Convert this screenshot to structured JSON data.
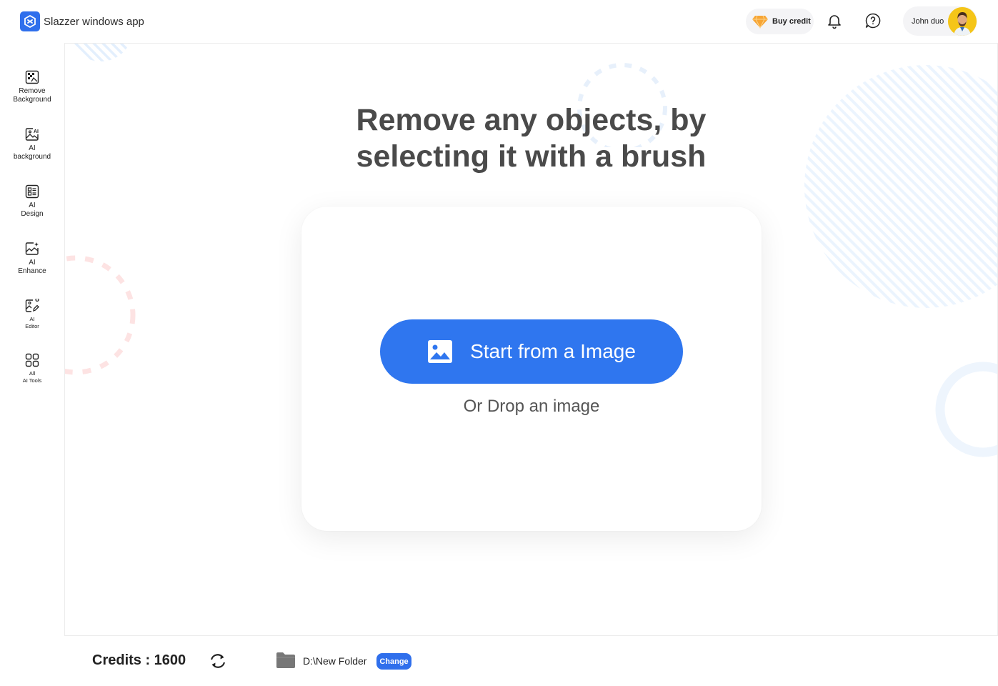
{
  "header": {
    "app_title": "Slazzer windows app",
    "buy_credit_label": "Buy credit",
    "user_name": "John duo"
  },
  "sidebar": {
    "items": [
      {
        "line1": "Remove",
        "line2": "Background",
        "icon": "remove-background-icon"
      },
      {
        "line1": "AI",
        "line2": "background",
        "icon": "ai-background-icon"
      },
      {
        "line1": "AI",
        "line2": "Design",
        "icon": "ai-design-icon"
      },
      {
        "line1": "AI",
        "line2": "Enhance",
        "icon": "ai-enhance-icon"
      },
      {
        "line1": "AI",
        "line2": "Editor",
        "icon": "ai-editor-icon"
      },
      {
        "line1": "All",
        "line2": "AI Tools",
        "icon": "grid-icon"
      }
    ]
  },
  "main": {
    "headline_line1": "Remove any objects, by",
    "headline_line2": "selecting it with a brush",
    "start_button_label": "Start from a Image",
    "drop_text": "Or Drop an image"
  },
  "footer": {
    "credits_label": "Credits : 1600",
    "folder_path": "D:\\New Folder",
    "change_label": "Change"
  },
  "colors": {
    "accent": "#2f76ef",
    "headline": "#4a4a4a"
  }
}
